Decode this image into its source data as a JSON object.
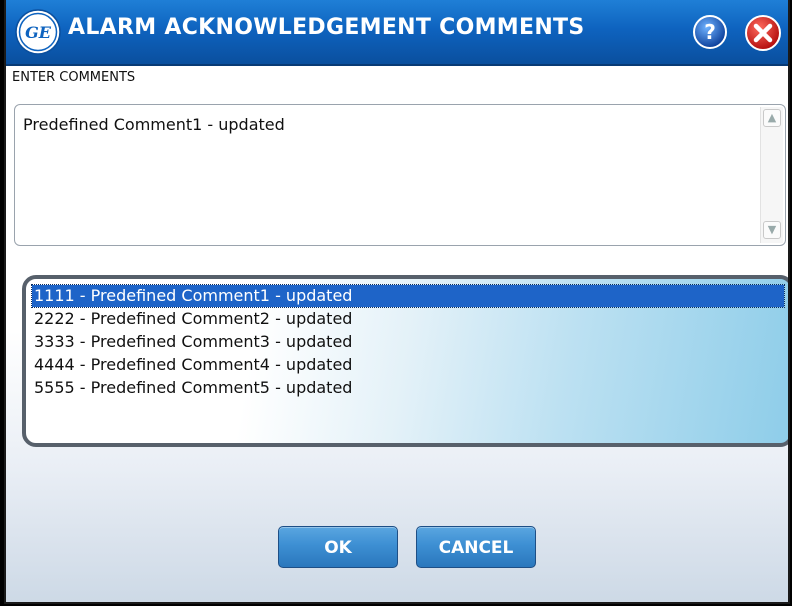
{
  "window": {
    "title": "ALARM ACKNOWLEDGEMENT COMMENTS",
    "logo_text": "GE"
  },
  "colors": {
    "titlebar": "#0e63bf",
    "selected_item": "#1e64c8",
    "button": "#3d8fd3",
    "close": "#d42020"
  },
  "form": {
    "comments_label": "ENTER COMMENTS",
    "comment_value": "Predefined Comment1 - updated"
  },
  "predefined_comments": [
    {
      "text": "1111 - Predefined Comment1 - updated",
      "selected": true
    },
    {
      "text": "2222 - Predefined Comment2 - updated",
      "selected": false
    },
    {
      "text": "3333 - Predefined Comment3 - updated",
      "selected": false
    },
    {
      "text": "4444 - Predefined Comment4 - updated",
      "selected": false
    },
    {
      "text": "5555 - Predefined Comment5 - updated",
      "selected": false
    }
  ],
  "buttons": {
    "ok_label": "OK",
    "cancel_label": "CANCEL"
  },
  "icons": {
    "logo": "ge-logo-icon",
    "help": "help-icon",
    "close": "close-icon",
    "scroll_up": "chevron-up-icon",
    "scroll_down": "chevron-down-icon"
  }
}
